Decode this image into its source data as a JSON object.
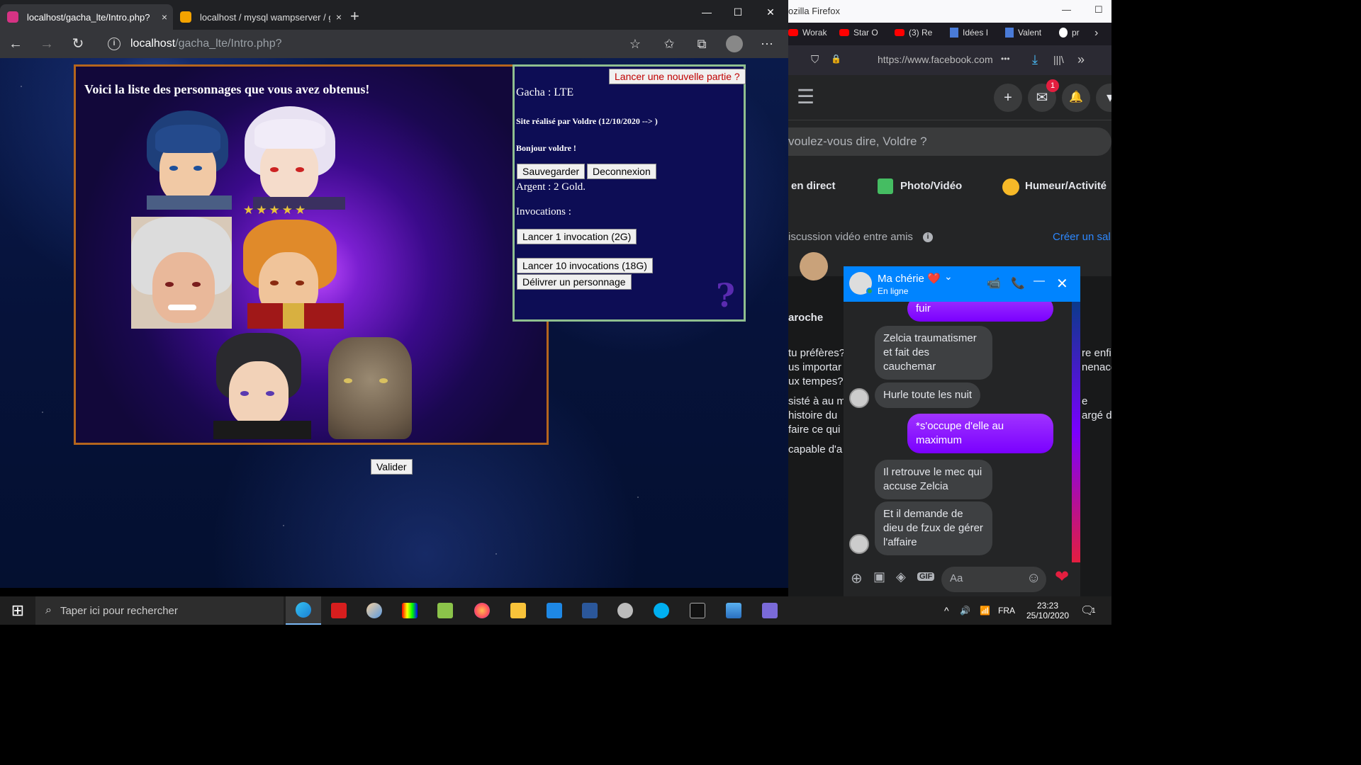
{
  "edge": {
    "tabs": [
      {
        "title": "localhost/gacha_lte/Intro.php?",
        "close": "×"
      },
      {
        "title": "localhost / mysql wampserver / g",
        "close": "×"
      }
    ],
    "new_tab": "+",
    "window": {
      "minimize": "—",
      "maximize": "☐",
      "close": "✕"
    },
    "nav": {
      "back": "←",
      "forward": "→",
      "refresh": "↻",
      "info": "i"
    },
    "url_host": "localhost",
    "url_path": "/gacha_lte/Intro.php?",
    "toolbar_icons": {
      "favorite": "☆",
      "favorites_list": "✩",
      "collections": "⧉",
      "more": "⋯"
    }
  },
  "game": {
    "gallery_title": "Voici la liste des personnages que vous avez obtenus!",
    "rating_stars": 5,
    "info": {
      "title": "Gacha : LTE",
      "credit": "Site réalisé par Voldre (12/10/2020 --> )",
      "greeting": "Bonjour voldre !",
      "money": "Argent : 2 Gold.",
      "invocations": "Invocations :",
      "help_icon": "?"
    },
    "buttons": {
      "new_game": "Lancer une nouvelle partie ?",
      "save": "Sauvegarder",
      "logout": "Deconnexion",
      "summon_1": "Lancer 1 invocation (2G)",
      "summon_10": "Lancer 10 invocations (18G)",
      "release": "Délivrer un personnage",
      "validate": "Valider"
    }
  },
  "firefox": {
    "title": "ozilla Firefox",
    "window_min": "—",
    "window_max": "☐",
    "bookmarks": [
      {
        "label": "Worak"
      },
      {
        "label": "Star O"
      },
      {
        "label": "(3) Re"
      },
      {
        "label": "Idées I"
      },
      {
        "label": "Valent"
      },
      {
        "label": "pr"
      }
    ],
    "bookmarks_more": "›",
    "url": "https://www.facebook.com",
    "url_icons": {
      "shield": "⛉",
      "lock": "🔒",
      "more": "•••",
      "download": "⤓",
      "library": "|||\\",
      "overflow": "»"
    }
  },
  "facebook": {
    "menu": "☰",
    "create": "+",
    "messenger_badge": "1",
    "notifications": "🔔",
    "post_prompt": "voulez-vous dire, Voldre ?",
    "actions": {
      "live": "en direct",
      "photo": "Photo/Vidéo",
      "feeling": "Humeur/Activité"
    },
    "rooms_label": "iscussion vidéo entre amis",
    "rooms_info": "i",
    "create_room": "Créer un sal",
    "feed_author": "aroche",
    "feed_lines": [
      "tu préfères?",
      "us importar",
      "ux tempes?",
      "sisté à au m",
      "histoire du",
      "faire ce qui",
      "capable d'a"
    ],
    "feed_right_lines": [
      "re enfi",
      "nenace",
      "e",
      "argé de"
    ]
  },
  "messenger": {
    "contact": "Ma chérie ❤️",
    "status": "En ligne",
    "chevron": "⌄",
    "icons": {
      "video": "📹",
      "call": "📞",
      "minimize": "—",
      "close": "✕"
    },
    "messages": [
      {
        "from": "me",
        "text": "fuir"
      },
      {
        "from": "them",
        "text": "Zelcia traumatismer et fait des cauchemar"
      },
      {
        "from": "them",
        "text": "Hurle toute les nuit"
      },
      {
        "from": "me",
        "text": "*s'occupe d'elle au maximum"
      },
      {
        "from": "them",
        "text": "Il retrouve le mec qui accuse Zelcia"
      },
      {
        "from": "them",
        "text": "Et il demande de dieu de fzux de gérer l'affaire"
      }
    ],
    "input_placeholder": "Aa",
    "footer_icons": {
      "plus": "⊕",
      "image": "▣",
      "sticker": "◈",
      "gif": "GIF",
      "emoji": "☺",
      "like": "❤"
    }
  },
  "taskbar": {
    "start": "⊞",
    "search_placeholder": "Taper ici pour rechercher",
    "tray": {
      "chevron": "^",
      "volume": "🔊",
      "network": "📶",
      "language": "FRA",
      "time": "23:23",
      "date": "25/10/2020",
      "notifications": "🗨",
      "notif_count": "1"
    }
  },
  "colors": {
    "accent_blue": "#0084ff",
    "gallery_border": "#b5651d",
    "info_border": "#8fbf8f",
    "fb_purple": "#8a00ff"
  }
}
